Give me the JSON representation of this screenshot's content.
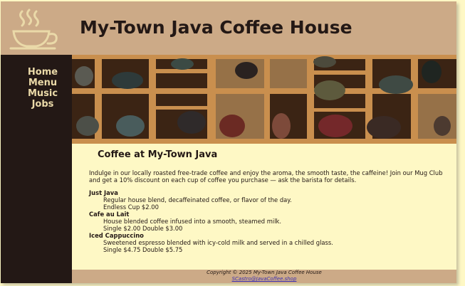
{
  "site": {
    "title": "My-Town Java Coffee House"
  },
  "nav": {
    "items": [
      "Home",
      "Menu",
      "Music",
      "Jobs"
    ]
  },
  "content": {
    "heading": "Coffee at My-Town Java",
    "intro": "Indulge in our locally roasted free-trade coffee and enjoy the aroma, the smooth taste, the caffeine! Join our Mug Club and get a 10% discount on each cup of coffee you purchase — ask the barista for details.",
    "menu": [
      {
        "name": "Just Java",
        "description": "Regular house blend, decaffeinated coffee, or flavor of the day.",
        "price": "Endless Cup $2.00"
      },
      {
        "name": "Cafe au Lait",
        "description": "House blended coffee infused into a smooth, steamed milk.",
        "price": "Single $2.00 Double $3.00"
      },
      {
        "name": "Iced Cappuccino",
        "description": "Sweetened espresso blended with icy-cold milk and served in a chilled glass.",
        "price": "Single $4.75 Double $5.75"
      }
    ]
  },
  "footer": {
    "copyright": "Copyright © 2025 My-Town Java Coffee House",
    "email": "SCastro@JavaCoffee.shop"
  },
  "colors": {
    "page_bg": "#fef8c5",
    "header_bg": "#ccaa87",
    "nav_bg": "#231815",
    "nav_text": "#ead9a8",
    "link": "#3a2fb3"
  }
}
